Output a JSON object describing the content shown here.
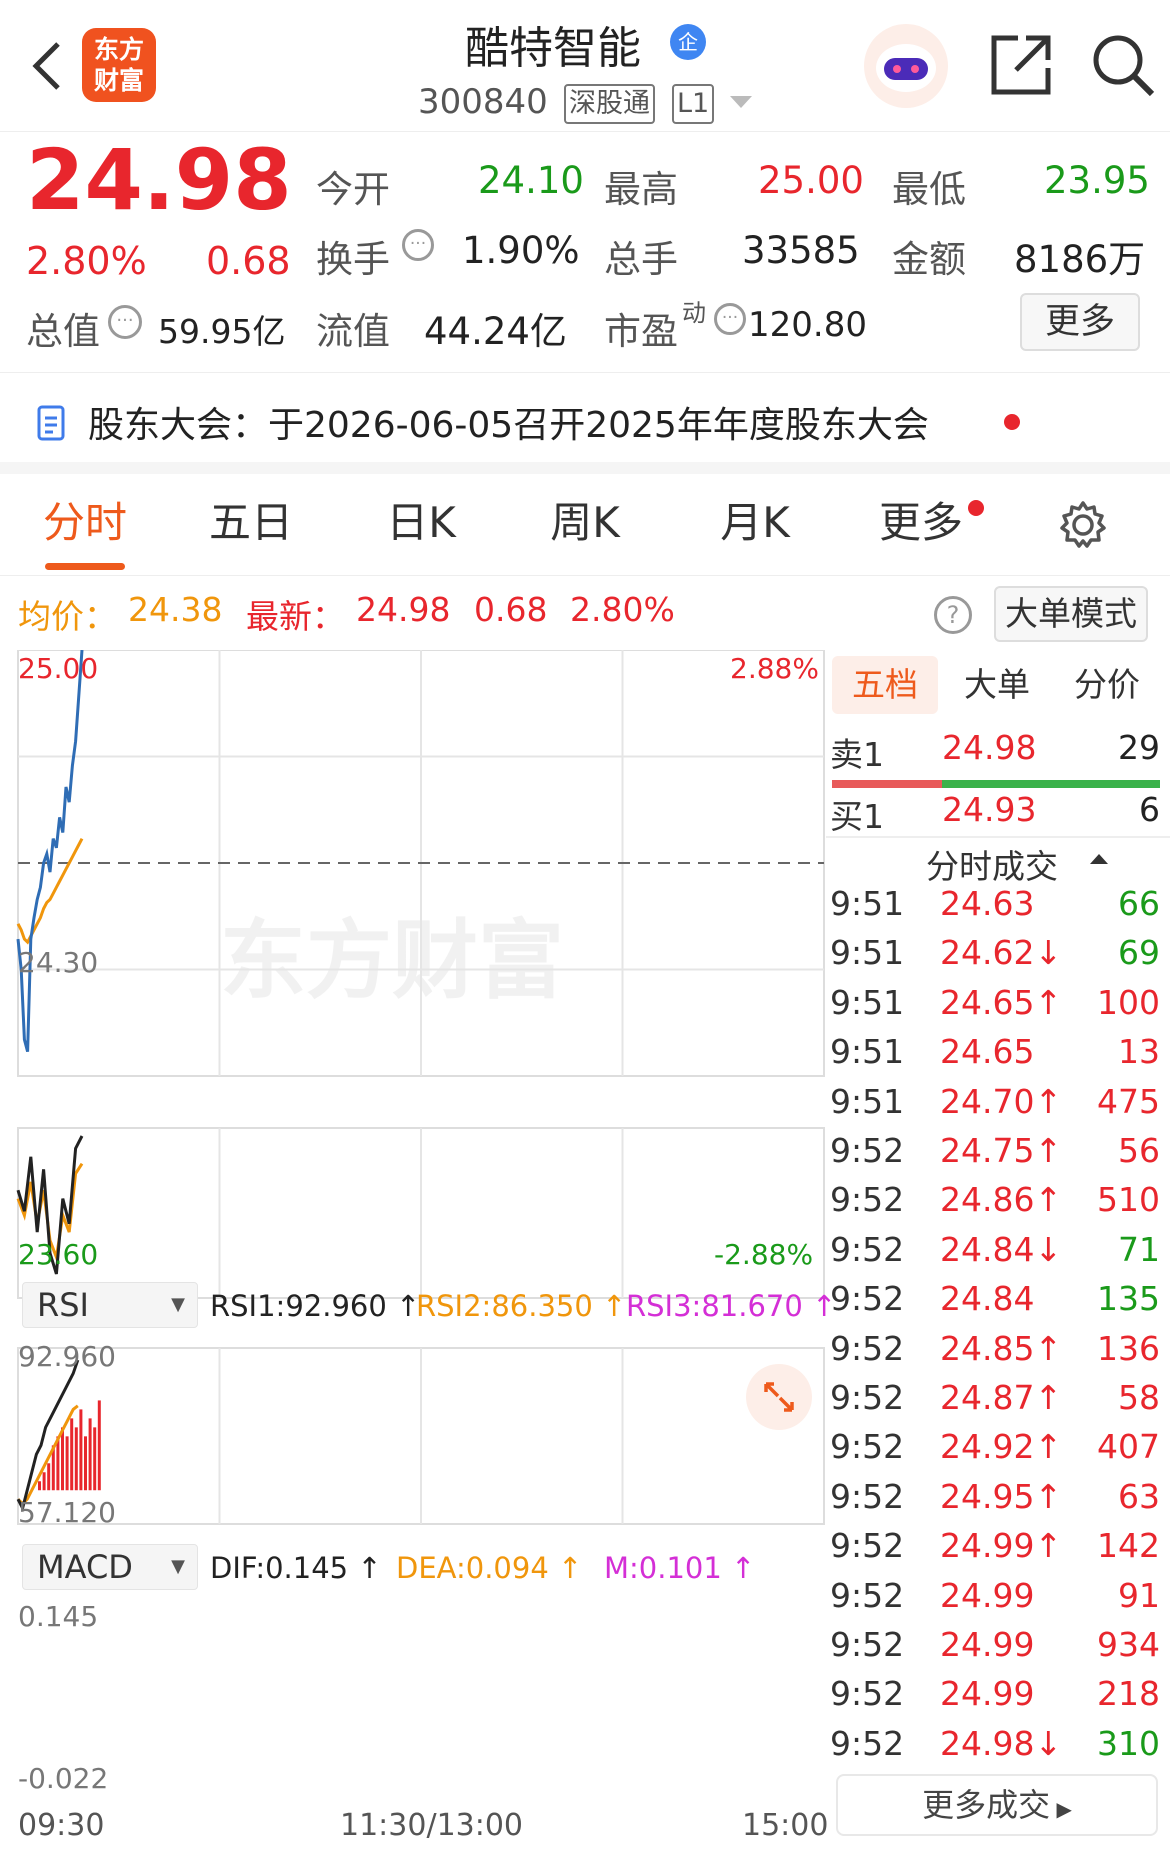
{
  "header": {
    "app_logo_text_1": "东方",
    "app_logo_text_2": "财富",
    "stock_name": "酷特智能",
    "badge": "企",
    "code": "300840",
    "tag1": "深股通",
    "tag2": "L1"
  },
  "quote": {
    "price": "24.98",
    "change_pct": "2.80%",
    "change": "0.68",
    "total_value_label": "总值",
    "total_value": "59.95亿",
    "fields": [
      {
        "label": "今开",
        "value": "24.10",
        "color": "green"
      },
      {
        "label": "最高",
        "value": "25.00",
        "color": "red"
      },
      {
        "label": "最低",
        "value": "23.95",
        "color": "green"
      },
      {
        "label": "换手",
        "value": "1.90%",
        "color": "black"
      },
      {
        "label": "总手",
        "value": "33585",
        "color": "black"
      },
      {
        "label": "金额",
        "value": "8186万",
        "color": "black"
      },
      {
        "label": "流值",
        "value": "44.24亿",
        "color": "black"
      },
      {
        "label": "市盈",
        "sup": "动",
        "value": "120.80",
        "color": "black"
      }
    ],
    "more_button": "更多"
  },
  "notice": {
    "text": "股东大会：于2026-06-05召开2025年年度股东大会"
  },
  "tabs": [
    "分时",
    "五日",
    "日K",
    "周K",
    "月K",
    "更多"
  ],
  "legend": {
    "avg_label": "均价：",
    "avg_value": "24.38",
    "latest_label": "最新：",
    "latest_value": "24.98",
    "latest_change": "0.68",
    "latest_pct": "2.80%",
    "help": "?",
    "big_order_mode": "大单模式"
  },
  "chart_data": {
    "type": "line",
    "price_axis": {
      "top": "25.00",
      "mid": "24.30",
      "bottom": "23.60"
    },
    "pct_axis": {
      "top": "2.88%",
      "bottom": "-2.88%"
    },
    "x_ticks": [
      "09:30",
      "11:30/13:00",
      "15:00"
    ],
    "watermark": "东方财富",
    "price_series": [
      24.05,
      23.95,
      23.72,
      23.68,
      24.05,
      24.12,
      24.18,
      24.22,
      24.3,
      24.33,
      24.27,
      24.38,
      24.35,
      24.45,
      24.4,
      24.55,
      24.5,
      24.62,
      24.7,
      24.85,
      25.0
    ],
    "avg_series": [
      24.1,
      24.08,
      24.05,
      24.04,
      24.06,
      24.08,
      24.1,
      24.12,
      24.15,
      24.17,
      24.18,
      24.2,
      24.22,
      24.24,
      24.26,
      24.28,
      24.3,
      24.32,
      24.34,
      24.36,
      24.38
    ]
  },
  "rsi": {
    "name": "RSI",
    "rsi1": "RSI1:92.960 ↑",
    "rsi2": "RSI2:86.350 ↑",
    "rsi3": "RSI3:81.670 ↑",
    "max": "92.960",
    "min": "57.120",
    "series1": [
      80,
      75,
      88,
      70,
      85,
      65,
      60,
      78,
      72,
      90,
      92.96
    ],
    "series2": [
      78,
      74,
      82,
      72,
      80,
      68,
      64,
      74,
      70,
      84,
      86.35
    ]
  },
  "macd": {
    "name": "MACD",
    "dif": "DIF:0.145 ↑",
    "dea": "DEA:0.094 ↑",
    "m": "M:0.101 ↑",
    "max": "0.145",
    "min": "-0.022",
    "dif_series": [
      -0.01,
      -0.02,
      0.0,
      0.02,
      0.04,
      0.05,
      0.07,
      0.08,
      0.09,
      0.1,
      0.11,
      0.12,
      0.13,
      0.145
    ],
    "dea_series": [
      -0.01,
      -0.015,
      -0.01,
      0.0,
      0.01,
      0.02,
      0.03,
      0.04,
      0.05,
      0.06,
      0.07,
      0.08,
      0.09,
      0.094
    ],
    "hist": [
      0.01,
      0.02,
      0.03,
      0.05,
      0.06,
      0.07,
      0.06,
      0.08,
      0.07,
      0.09,
      0.06,
      0.08,
      0.07,
      0.1
    ]
  },
  "side_tabs": [
    "五档",
    "大单",
    "分价"
  ],
  "order_book": {
    "sell": {
      "label": "卖1",
      "price": "24.98",
      "vol": "29"
    },
    "buy": {
      "label": "买1",
      "price": "24.93",
      "vol": "6"
    }
  },
  "trades_title": "分时成交",
  "trades": [
    {
      "t": "9:51",
      "p": "24.63",
      "v": "66",
      "c": "green"
    },
    {
      "t": "9:51",
      "p": "24.62↓",
      "v": "69",
      "c": "green"
    },
    {
      "t": "9:51",
      "p": "24.65↑",
      "v": "100",
      "c": "red"
    },
    {
      "t": "9:51",
      "p": "24.65",
      "v": "13",
      "c": "red"
    },
    {
      "t": "9:51",
      "p": "24.70↑",
      "v": "475",
      "c": "red"
    },
    {
      "t": "9:52",
      "p": "24.75↑",
      "v": "56",
      "c": "red"
    },
    {
      "t": "9:52",
      "p": "24.86↑",
      "v": "510",
      "c": "red"
    },
    {
      "t": "9:52",
      "p": "24.84↓",
      "v": "71",
      "c": "green"
    },
    {
      "t": "9:52",
      "p": "24.84",
      "v": "135",
      "c": "green"
    },
    {
      "t": "9:52",
      "p": "24.85↑",
      "v": "136",
      "c": "red"
    },
    {
      "t": "9:52",
      "p": "24.87↑",
      "v": "58",
      "c": "red"
    },
    {
      "t": "9:52",
      "p": "24.92↑",
      "v": "407",
      "c": "red"
    },
    {
      "t": "9:52",
      "p": "24.95↑",
      "v": "63",
      "c": "red"
    },
    {
      "t": "9:52",
      "p": "24.99↑",
      "v": "142",
      "c": "red"
    },
    {
      "t": "9:52",
      "p": "24.99",
      "v": "91",
      "c": "red"
    },
    {
      "t": "9:52",
      "p": "24.99",
      "v": "934",
      "c": "red"
    },
    {
      "t": "9:52",
      "p": "24.99",
      "v": "218",
      "c": "red"
    },
    {
      "t": "9:52",
      "p": "24.98↓",
      "v": "310",
      "c": "green"
    }
  ],
  "more_trades": "更多成交"
}
